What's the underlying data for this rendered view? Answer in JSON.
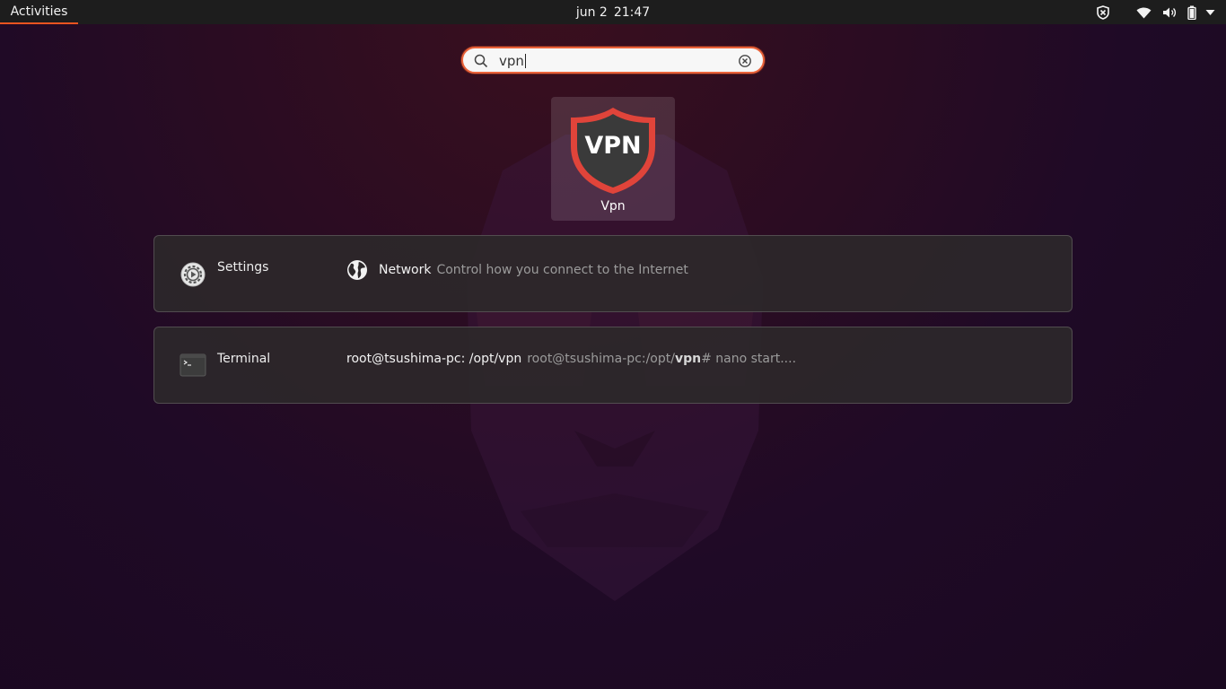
{
  "topbar": {
    "activities_label": "Activities",
    "clock_date": "jun 2",
    "clock_time": "21:47",
    "tray_icons": [
      "shield-icon",
      "wifi-icon",
      "volume-icon",
      "battery-icon",
      "chevron-down-icon"
    ]
  },
  "search": {
    "query": "vpn"
  },
  "app_results": [
    {
      "name": "Vpn",
      "icon": "vpn-shield-icon",
      "icon_text": "VPN"
    }
  ],
  "providers": [
    {
      "name": "Settings",
      "icon": "settings-icon",
      "result": {
        "icon": "globe-icon",
        "title": "Network",
        "description": "Control how you connect to the Internet"
      }
    },
    {
      "name": "Terminal",
      "icon": "terminal-icon",
      "result": {
        "title": "root@tsushima-pc: /opt/vpn",
        "description_prefix": "root@tsushima-pc:/opt/",
        "description_match": "vpn",
        "description_suffix": "# nano start...."
      }
    }
  ],
  "colors": {
    "accent": "#e95420",
    "topbar_bg": "#1d1d1d",
    "panel_bg": "#2c282a",
    "vpn_shield_red": "#e0443a",
    "vpn_shield_dark": "#3a3a3a"
  }
}
